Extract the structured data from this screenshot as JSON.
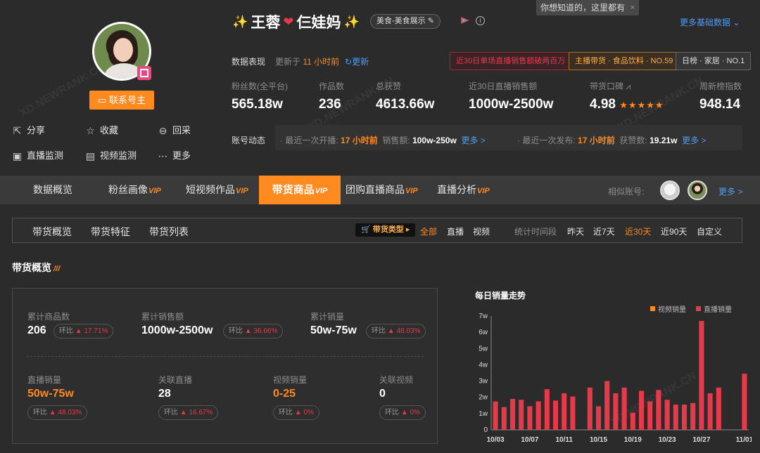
{
  "tooltip": {
    "text": "你想知道的，这里都有",
    "close": "×"
  },
  "profile": {
    "name": "王蓉",
    "name_suffix": "仨娃妈",
    "category_tag": "美食-美食展示",
    "contact_button": "联系号主",
    "more_basic_data": "更多基础数据"
  },
  "side_actions": [
    {
      "label": "分享",
      "icon": "share-icon"
    },
    {
      "label": "收藏",
      "icon": "star-icon"
    },
    {
      "label": "回采",
      "icon": "recollect-icon"
    },
    {
      "label": "直播监测",
      "icon": "live-monitor-icon"
    },
    {
      "label": "视频监测",
      "icon": "video-monitor-icon"
    },
    {
      "label": "更多",
      "icon": "more-icon"
    }
  ],
  "performance": {
    "label": "数据表现",
    "updated_prefix": "更新于",
    "updated_time": "11 小时前",
    "refresh": "更新",
    "badges": [
      "近30日单场直播销售额破两百万",
      "主播带货 · 食品饮料 · NO.59",
      "日榜 · 家居 · NO.1"
    ]
  },
  "stats": [
    {
      "label": "粉丝数(全平台)",
      "value": "565.18w"
    },
    {
      "label": "作品数",
      "value": "236"
    },
    {
      "label": "总获赞",
      "value": "4613.66w"
    },
    {
      "label": "近30日直播销售额",
      "value": "1000w-2500w"
    },
    {
      "label": "带货口碑",
      "value": "4.98",
      "stars": "★★★★★"
    },
    {
      "label": "周新榜指数",
      "value": "948.14"
    }
  ],
  "dynamics": {
    "label": "账号动态",
    "live": {
      "prefix": "最近一次开播:",
      "time": "17 小时前",
      "sales_label": "销售额:",
      "sales": "100w-250w",
      "more": "更多 >"
    },
    "post": {
      "prefix": "最近一次发布:",
      "time": "17 小时前",
      "likes_label": "获赞数:",
      "likes": "19.21w",
      "more": "更多 >"
    }
  },
  "tabs": [
    {
      "label": "数据概览",
      "vip": ""
    },
    {
      "label": "粉丝画像",
      "vip": "VIP"
    },
    {
      "label": "短视频作品",
      "vip": "VIP"
    },
    {
      "label": "带货商品",
      "vip": "VIP"
    },
    {
      "label": "团购直播商品",
      "vip": "VIP"
    },
    {
      "label": "直播分析",
      "vip": "VIP"
    }
  ],
  "similar": {
    "label": "相似账号:",
    "more": "更多 >"
  },
  "subnav": {
    "tabs": [
      "带货概览",
      "带货特征",
      "带货列表"
    ],
    "type_badge": "带货类型",
    "types": [
      "全部",
      "直播",
      "视频"
    ],
    "period_label": "统计时间段",
    "periods": [
      "昨天",
      "近7天",
      "近30天",
      "近90天",
      "自定义"
    ]
  },
  "section_title": "带货概览",
  "overview": {
    "row1": [
      {
        "label": "累计商品数",
        "value": "206",
        "chip_prefix": "环比",
        "chip_value": "▲ 17.71%"
      },
      {
        "label": "累计销售额",
        "value": "1000w-2500w",
        "chip_prefix": "环比",
        "chip_value": "▲ 36.66%"
      },
      {
        "label": "累计销量",
        "value": "50w-75w",
        "chip_prefix": "环比",
        "chip_value": "▲ 48.03%"
      }
    ],
    "row2": [
      {
        "label": "直播销量",
        "value": "50w-75w",
        "chip_prefix": "环比",
        "chip_value": "▲ 48.03%"
      },
      {
        "label": "关联直播",
        "value": "28",
        "chip_prefix": "环比",
        "chip_value": "▲ 16.67%"
      },
      {
        "label": "视频销量",
        "value": "0-25",
        "chip_prefix": "环比",
        "chip_value": "▲ 0%"
      },
      {
        "label": "关联视频",
        "value": "0",
        "chip_prefix": "环比",
        "chip_value": "▲ 0%"
      }
    ]
  },
  "colors": {
    "accent": "#ff8a1f",
    "live_bar": "#e8394a",
    "link": "#4d9cf5"
  },
  "chart_data": {
    "type": "bar",
    "title": "每日销量走势",
    "legend": [
      "视频销量",
      "直播销量"
    ],
    "ylim": [
      0,
      7
    ],
    "y_ticks": [
      "0",
      "1w",
      "2w",
      "3w",
      "4w",
      "5w",
      "6w",
      "7w"
    ],
    "x_tick_labels": [
      "10/03",
      "10/07",
      "10/11",
      "10/15",
      "10/19",
      "10/23",
      "10/27",
      "11/01"
    ],
    "x": [
      "10/03",
      "10/04",
      "10/05",
      "10/06",
      "10/07",
      "10/08",
      "10/09",
      "10/10",
      "10/11",
      "10/12",
      "10/13",
      "10/14",
      "10/15",
      "10/16",
      "10/17",
      "10/18",
      "10/19",
      "10/20",
      "10/21",
      "10/22",
      "10/23",
      "10/24",
      "10/25",
      "10/26",
      "10/27",
      "10/28",
      "10/29",
      "10/30",
      "10/31",
      "11/01"
    ],
    "series": [
      {
        "name": "视频销量",
        "values": [
          0,
          0,
          0,
          0,
          0,
          0,
          0,
          0,
          0,
          0,
          0,
          0,
          0,
          0,
          0,
          0,
          0,
          0,
          0,
          0,
          0,
          0,
          0,
          0,
          0,
          0,
          0,
          0,
          0,
          0
        ]
      },
      {
        "name": "直播销量",
        "values": [
          1.75,
          1.4,
          1.9,
          1.85,
          1.45,
          1.75,
          2.5,
          1.8,
          2.25,
          2.05,
          0,
          2.6,
          1.45,
          3.0,
          2.25,
          2.6,
          1.05,
          2.4,
          1.75,
          2.45,
          1.85,
          1.55,
          1.55,
          1.65,
          6.7,
          2.25,
          2.6,
          0,
          0,
          3.45
        ]
      }
    ]
  }
}
